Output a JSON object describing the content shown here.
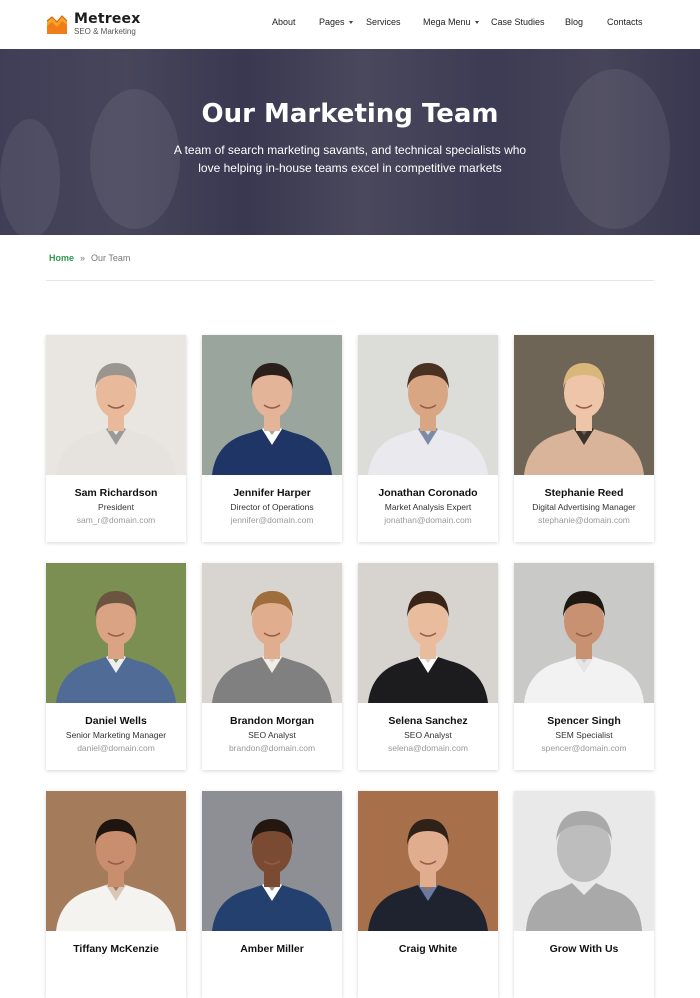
{
  "brand": {
    "name": "Metreex",
    "tagline": "SEO & Marketing",
    "accent": "#f08a1c"
  },
  "nav": [
    {
      "label": "About",
      "dropdown": false
    },
    {
      "label": "Pages",
      "dropdown": true
    },
    {
      "label": "Services",
      "dropdown": false
    },
    {
      "label": "Mega Menu",
      "dropdown": true
    },
    {
      "label": "Case Studies",
      "dropdown": false
    },
    {
      "label": "Blog",
      "dropdown": false
    },
    {
      "label": "Contacts",
      "dropdown": false
    }
  ],
  "hero": {
    "title": "Our Marketing Team",
    "subtitle": "A team of search marketing savants, and technical specialists who love helping in-house teams excel in competitive markets"
  },
  "breadcrumb": {
    "home": "Home",
    "separator": "»",
    "current": "Our Team",
    "home_color": "#2e9a4d"
  },
  "team": [
    {
      "name": "Sam Richardson",
      "role": "President",
      "email": "sam_r@domain.com",
      "photo": "man-grey-hair-argyle-sweater"
    },
    {
      "name": "Jennifer Harper",
      "role": "Director of Operations",
      "email": "jennifer@domain.com",
      "photo": "woman-dark-hair-glasses-blazer"
    },
    {
      "name": "Jonathan Coronado",
      "role": "Market Analysis Expert",
      "email": "jonathan@domain.com",
      "photo": "man-beard-plaid-shirt-tablet"
    },
    {
      "name": "Stephanie Reed",
      "role": "Digital Advertising Manager",
      "email": "stephanie@domain.com",
      "photo": "woman-blonde-glasses-office"
    },
    {
      "name": "Daniel Wells",
      "role": "Senior Marketing Manager",
      "email": "daniel@domain.com",
      "photo": "man-plaid-shirt-park"
    },
    {
      "name": "Brandon Morgan",
      "role": "SEO Analyst",
      "email": "brandon@domain.com",
      "photo": "man-beard-grey-sweater"
    },
    {
      "name": "Selena Sanchez",
      "role": "SEO Analyst",
      "email": "selena@domain.com",
      "photo": "woman-dark-hair-black-blazer"
    },
    {
      "name": "Spencer Singh",
      "role": "SEM Specialist",
      "email": "spencer@domain.com",
      "photo": "man-short-hair-white-shirt"
    },
    {
      "name": "Tiffany McKenzie",
      "role": "",
      "email": "",
      "photo": "woman-dark-hair-stairs"
    },
    {
      "name": "Amber Miller",
      "role": "",
      "email": "",
      "photo": "woman-curly-hair-blazer"
    },
    {
      "name": "Craig White",
      "role": "",
      "email": "",
      "photo": "man-glasses-beard-blazer"
    },
    {
      "name": "Grow With Us",
      "role": "",
      "email": "",
      "photo": "placeholder-silhouette"
    }
  ]
}
